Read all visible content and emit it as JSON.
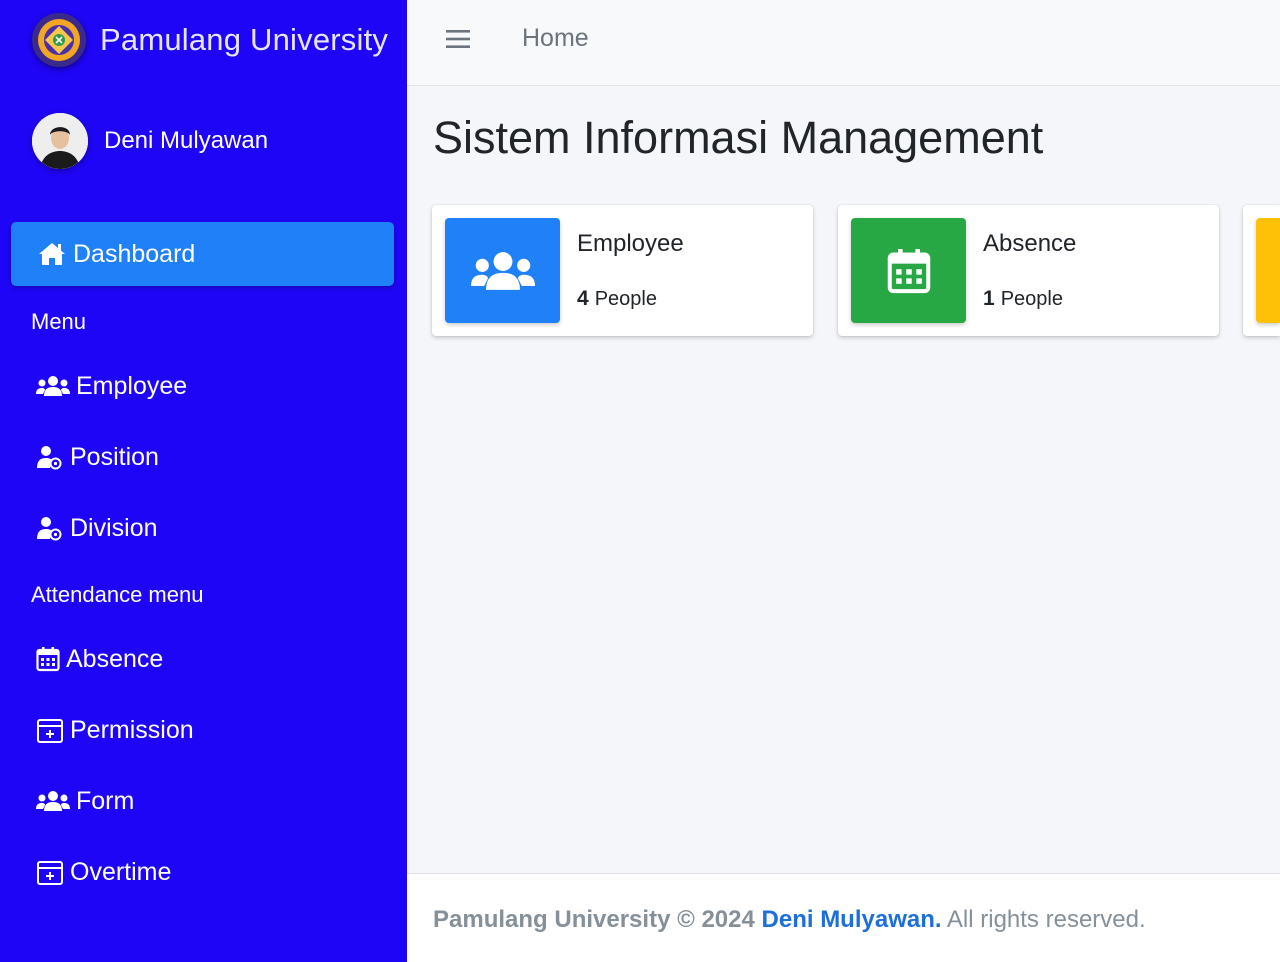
{
  "brand": {
    "name": "Pamulang University",
    "icon": "university-logo"
  },
  "user": {
    "name": "Deni Mulyawan",
    "icon": "user-avatar"
  },
  "sidebar": {
    "active": {
      "label": "Dashboard",
      "icon": "home-icon"
    },
    "sections": [
      {
        "header": "Menu",
        "items": [
          {
            "label": "Employee",
            "icon": "users-icon"
          },
          {
            "label": "Position",
            "icon": "user-cog-icon"
          },
          {
            "label": "Division",
            "icon": "user-cog-icon"
          }
        ]
      },
      {
        "header": "Attendance menu",
        "items": [
          {
            "label": "Absence",
            "icon": "calendar-icon"
          },
          {
            "label": "Permission",
            "icon": "calendar-plus-icon"
          },
          {
            "label": "Form",
            "icon": "users-icon"
          },
          {
            "label": "Overtime",
            "icon": "calendar-plus-icon"
          }
        ]
      }
    ]
  },
  "topbar": {
    "home_label": "Home",
    "menu_icon": "hamburger-icon"
  },
  "main": {
    "title": "Sistem Informasi Management",
    "cards": [
      {
        "label": "Employee",
        "count": "4",
        "unit": "People",
        "color": "#1f80f7",
        "icon": "users-icon"
      },
      {
        "label": "Absence",
        "count": "1",
        "unit": "People",
        "color": "#28a745",
        "icon": "calendar-icon"
      },
      {
        "color": "#ffc107"
      }
    ]
  },
  "footer": {
    "brand": "Pamulang University",
    "copyright": "© 2024",
    "author": "Deni Mulyawan.",
    "rights": "All rights reserved."
  },
  "colors": {
    "sidebar": "#1f05f5",
    "accent": "#1f80f7",
    "success": "#28a745",
    "warning": "#ffc107"
  }
}
